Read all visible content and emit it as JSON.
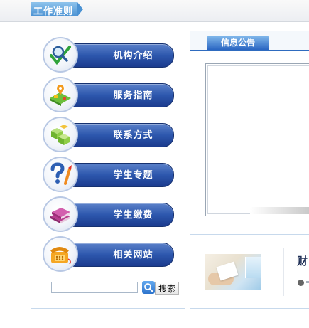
{
  "header": {
    "tag_label": "工作准则"
  },
  "left_menu": {
    "items": [
      {
        "label": "机构介绍",
        "icon": "magnifier-check-icon"
      },
      {
        "label": "服务指南",
        "icon": "map-pin-icon"
      },
      {
        "label": "联系方式",
        "icon": "green-cubes-icon"
      },
      {
        "label": "学生专题",
        "icon": "question-mark-icon"
      },
      {
        "label": "学生缴费",
        "icon": "books-icon"
      },
      {
        "label": "相关网站",
        "icon": "telephone-icon"
      }
    ]
  },
  "search": {
    "value": "",
    "placeholder": "",
    "button_label": "搜索"
  },
  "notice": {
    "tab_label": "信息公告"
  },
  "bottom": {
    "title_fragment": "财"
  },
  "colors": {
    "menu_pill": "#2d57ad",
    "tab_blue": "#2a66c2",
    "panel_border": "#c7d9ec"
  }
}
